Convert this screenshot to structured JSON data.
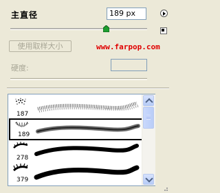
{
  "brush_options": {
    "master_diameter_label": "主直径",
    "master_diameter_value": "189 px",
    "diameter_slider_fraction": 0.7,
    "use_sample_size_label": "使用取样大小",
    "watermark_text": "www.farpop.com",
    "hardness_label": "硬度:",
    "hardness_value": ""
  },
  "brush_list": {
    "items": [
      {
        "size": "187",
        "selected": false
      },
      {
        "size": "189",
        "selected": true
      },
      {
        "size": "278",
        "selected": false
      },
      {
        "size": "379",
        "selected": false
      }
    ]
  },
  "colors": {
    "panel_bg": "#ece9d8",
    "watermark": "#e00000",
    "selection_border": "#000000",
    "input_border": "#7f9db9"
  }
}
